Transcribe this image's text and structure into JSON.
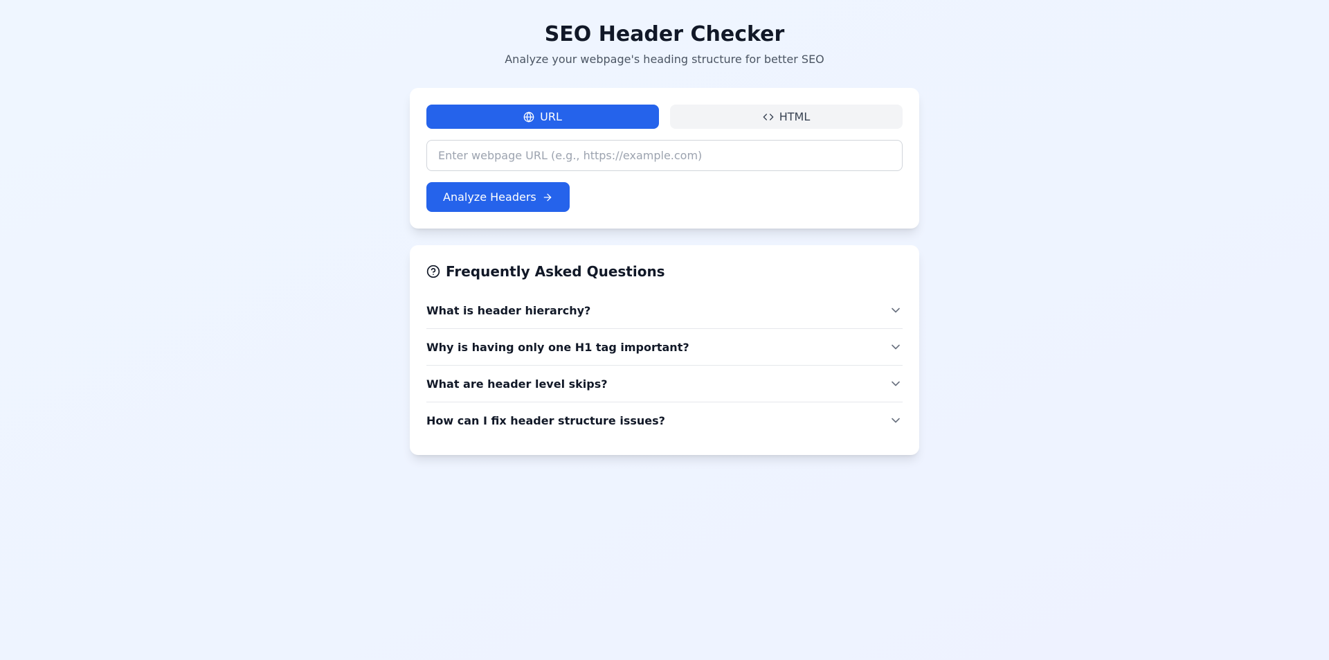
{
  "header": {
    "title": "SEO Header Checker",
    "subtitle": "Analyze your webpage's heading structure for better SEO"
  },
  "tabs": {
    "url_label": "URL",
    "html_label": "HTML"
  },
  "input": {
    "url_placeholder": "Enter webpage URL (e.g., https://example.com)",
    "url_value": ""
  },
  "actions": {
    "analyze_label": "Analyze Headers"
  },
  "faq": {
    "title": "Frequently Asked Questions",
    "items": [
      {
        "question": "What is header hierarchy?"
      },
      {
        "question": "Why is having only one H1 tag important?"
      },
      {
        "question": "What are header level skips?"
      },
      {
        "question": "How can I fix header structure issues?"
      }
    ]
  }
}
